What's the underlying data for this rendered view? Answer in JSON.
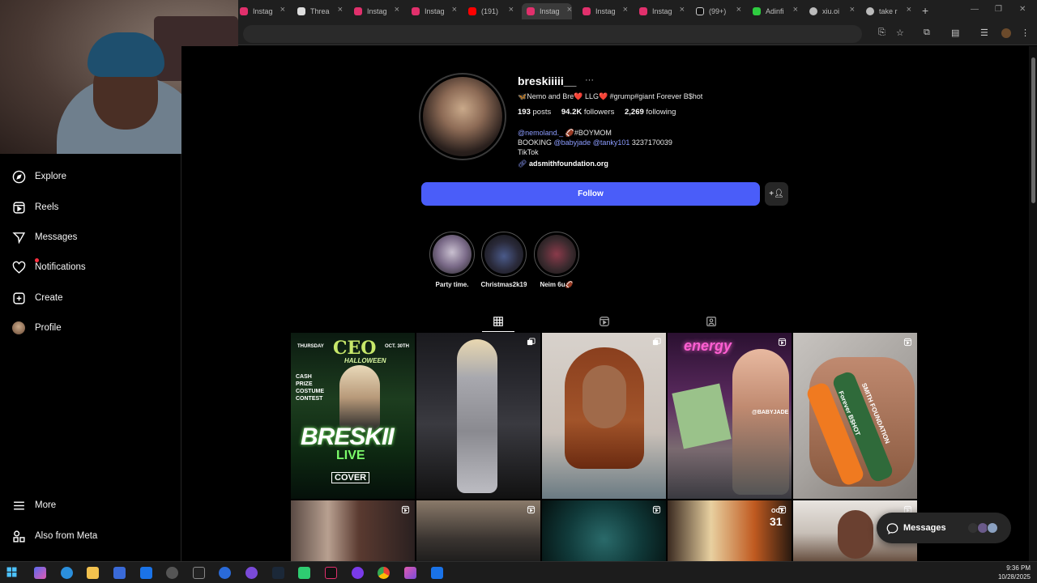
{
  "browser": {
    "tabs": [
      {
        "label": "Instag",
        "color": "#e1306c"
      },
      {
        "label": "Threa",
        "color": "#ffffff"
      },
      {
        "label": "Instag",
        "color": "#e1306c"
      },
      {
        "label": "Instag",
        "color": "#e1306c"
      },
      {
        "label": "(191)",
        "color": "#ff0000"
      },
      {
        "label": "Instag",
        "color": "#e1306c"
      },
      {
        "label": "Instag",
        "color": "#e1306c"
      },
      {
        "label": "Instag",
        "color": "#e1306c"
      },
      {
        "label": "(99+)",
        "color": "#ffffff"
      },
      {
        "label": "Adinfi",
        "color": "#2ecc40"
      },
      {
        "label": "xiu.oi",
        "color": "#bbbbbb"
      },
      {
        "label": "take r",
        "color": "#bbbbbb"
      }
    ],
    "active_tab": 5
  },
  "sidebar": {
    "items": [
      {
        "label": "Explore",
        "icon": "compass-icon"
      },
      {
        "label": "Reels",
        "icon": "reels-icon"
      },
      {
        "label": "Messages",
        "icon": "messenger-icon"
      },
      {
        "label": "Notifications",
        "icon": "heart-icon"
      },
      {
        "label": "Create",
        "icon": "plus-square-icon"
      },
      {
        "label": "Profile",
        "icon": "avatar-icon"
      }
    ],
    "bottom": [
      {
        "label": "More",
        "icon": "menu-icon"
      },
      {
        "label": "Also from Meta",
        "icon": "meta-icon"
      }
    ]
  },
  "profile": {
    "username": "breskiiiii__",
    "name_line": "🦋Nemo and Bre❤️ LLG❤️ #grump#giant Forever B$hot",
    "posts_count": "193",
    "posts_label": "posts",
    "followers_count": "94.2K",
    "followers_label": "followers",
    "following_count": "2,269",
    "following_label": "following",
    "bio": {
      "line1_mention": "@nemoland._",
      "line1_rest": " 🏈#BOYMOM",
      "line2_prefix": "BOOKING ",
      "line2_mention1": "@babyjade",
      "line2_space": " ",
      "line2_mention2": "@tanky101",
      "line2_rest": " 3237170039",
      "line3": "TikTok",
      "link": "adsmithfoundation.org"
    },
    "follow_label": "Follow"
  },
  "highlights": [
    {
      "label": "Party time."
    },
    {
      "label": "Christmas2k19"
    },
    {
      "label": "Neim 6u🏈"
    }
  ],
  "posts": {
    "row1": [
      {
        "text_top": "CEO",
        "text_script": "HALLOWEEN",
        "text_main": "BRESKII",
        "text_sub": "LIVE",
        "text_venue": "COVER",
        "text_thu": "THURSDAY",
        "text_date": "OCT. 30TH",
        "text_prize": "CASH PRIZE COSTUME CONTEST"
      },
      {},
      {},
      {
        "text_top": "energy",
        "text_tag": "@BABYJADE"
      },
      {
        "text_band1": "SMITH FOUNDATION",
        "text_band2": "Forever B$HOT"
      }
    ],
    "row2": [
      {},
      {},
      {},
      {
        "text_oct": "OCT",
        "text_day": "31"
      },
      {}
    ]
  },
  "messages_pill": {
    "label": "Messages"
  },
  "taskbar": {
    "time": "9:36 PM",
    "date": "10/28/2025"
  },
  "colors": {
    "accent": "#4a5df9",
    "link": "#8c9cff",
    "notification": "#ff3040"
  }
}
